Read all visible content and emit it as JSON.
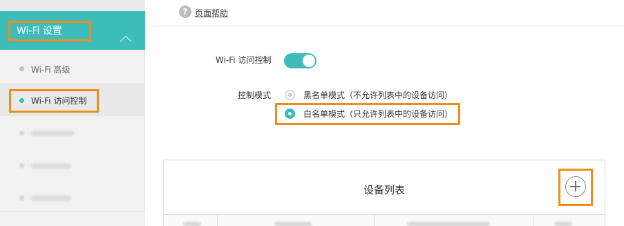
{
  "sidebar": {
    "header_label": "Wi-Fi 设置",
    "items": [
      {
        "label": "Wi-Fi 高级"
      },
      {
        "label": "Wi-Fi 访问控制"
      }
    ]
  },
  "topbar": {
    "help_link": "页面帮助"
  },
  "access_control": {
    "wifi_label": "Wi-Fi 访问控制",
    "toggle_on": true,
    "mode_label": "控制模式",
    "blacklist_option": "黑名单模式（不允许列表中的设备访问）",
    "whitelist_option": "白名单模式（只允许列表中的设备访问）",
    "selected_mode": "whitelist"
  },
  "device_list": {
    "title": "设备列表"
  },
  "colors": {
    "accent": "#3dbcbc",
    "highlight_frame": "#f08c1a"
  },
  "icons": [
    "chevron-up-icon",
    "help-icon",
    "add-icon"
  ]
}
